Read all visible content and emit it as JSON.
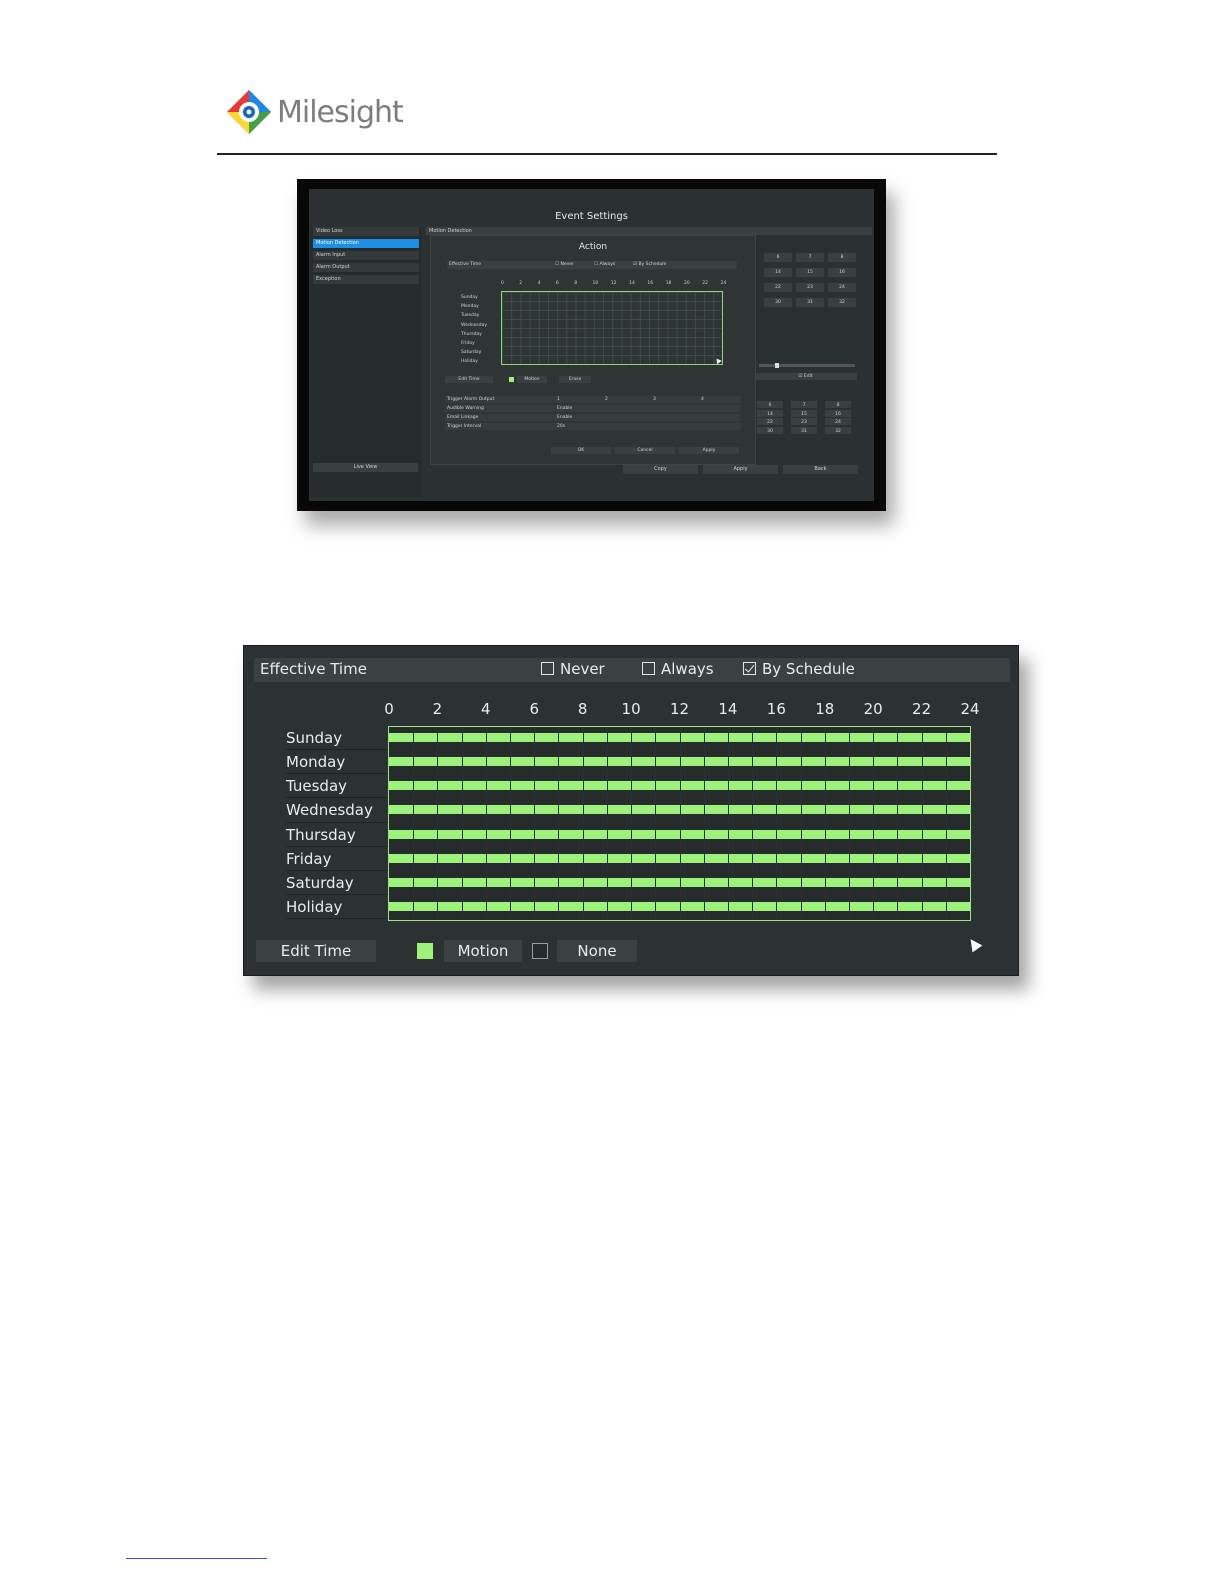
{
  "brand": {
    "name": "Milesight"
  },
  "screenshot_small": {
    "window_title": "Event Settings",
    "sidebar": {
      "items": [
        "Video Loss",
        "Motion Detection",
        "Alarm Input",
        "Alarm Output",
        "Exception"
      ],
      "active_index": 1,
      "live_view_label": "Live View"
    },
    "main_header": "Motion Detection",
    "dialog": {
      "title": "Action",
      "effective_time_label": "Effective Time",
      "options": [
        "Never",
        "Always",
        "By Schedule"
      ],
      "hours": [
        "0",
        "2",
        "4",
        "6",
        "8",
        "10",
        "12",
        "14",
        "16",
        "18",
        "20",
        "22",
        "24"
      ],
      "days": [
        "Sunday",
        "Monday",
        "Tuesday",
        "Wednesday",
        "Thursday",
        "Friday",
        "Saturday",
        "Holiday"
      ],
      "edit_time": "Edit Time",
      "motion": "Motion",
      "erase": "Erase",
      "rows": [
        {
          "label": "Trigger Alarm Output",
          "values": [
            "1",
            "2",
            "3",
            "4"
          ]
        },
        {
          "label": "Audible Warning",
          "values": [
            "Enable"
          ]
        },
        {
          "label": "Email Linkage",
          "values": [
            "Enable"
          ]
        },
        {
          "label": "Trigger Interval",
          "values": [
            "20s"
          ]
        }
      ],
      "ok": "OK",
      "cancel": "Cancel",
      "apply": "Apply"
    },
    "channel_grid_top": [
      "6",
      "7",
      "8",
      "14",
      "15",
      "16",
      "22",
      "23",
      "24",
      "30",
      "31",
      "32"
    ],
    "channel_grid_bottom": [
      "6",
      "7",
      "8",
      "14",
      "15",
      "16",
      "22",
      "23",
      "24",
      "30",
      "31",
      "32"
    ],
    "edit_label": "Edit",
    "bottom_buttons": [
      "Copy",
      "Apply",
      "Back"
    ]
  },
  "schedule": {
    "effective_time_label": "Effective Time",
    "options": [
      {
        "label": "Never",
        "checked": false
      },
      {
        "label": "Always",
        "checked": false
      },
      {
        "label": "By Schedule",
        "checked": true
      }
    ],
    "hours": [
      "0",
      "2",
      "4",
      "6",
      "8",
      "10",
      "12",
      "14",
      "16",
      "18",
      "20",
      "22",
      "24"
    ],
    "days": [
      "Sunday",
      "Monday",
      "Tuesday",
      "Wednesday",
      "Thursday",
      "Friday",
      "Saturday",
      "Holiday"
    ],
    "fill_fraction_per_day": [
      1,
      1,
      1,
      1,
      1,
      1,
      1,
      1
    ],
    "edit_time_label": "Edit Time",
    "legend": [
      {
        "label": "Motion",
        "color": "#9df27a"
      },
      {
        "label": "None",
        "color": "#262b2c"
      }
    ]
  }
}
